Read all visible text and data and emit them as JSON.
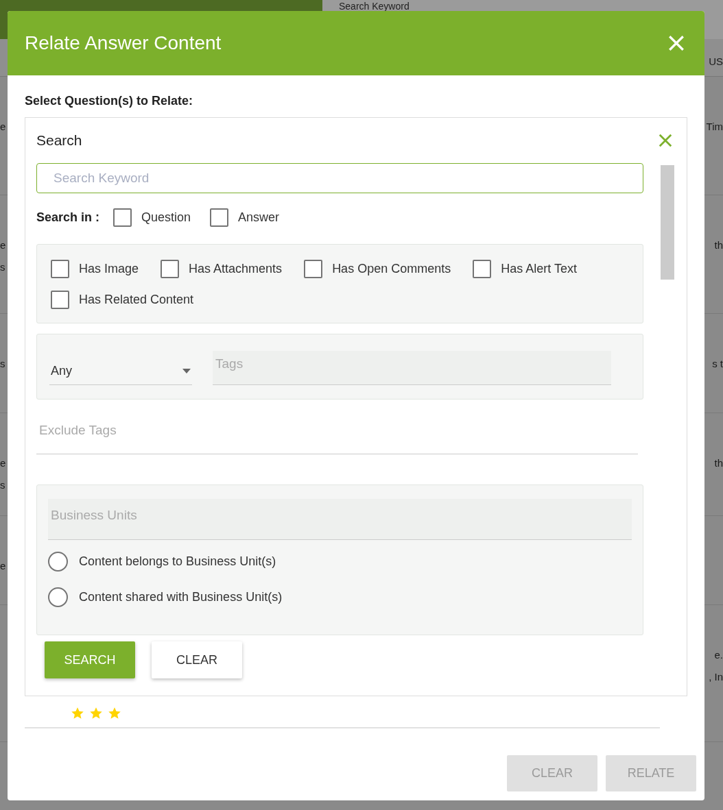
{
  "background": {
    "search_placeholder": "Search Keyword",
    "header_tab": "US",
    "rows": [
      {
        "left": [
          "e"
        ],
        "right": [
          "Tim"
        ]
      },
      {
        "left": [
          "e",
          "s"
        ],
        "right": [
          "th"
        ]
      },
      {
        "left": [
          "s"
        ],
        "right": [
          "s t"
        ]
      },
      {
        "left": [
          "e",
          "s"
        ],
        "right": [
          "th"
        ]
      },
      {
        "left": [
          "e"
        ]
      },
      {
        "right": [
          "e.",
          ", In"
        ]
      }
    ]
  },
  "dialog": {
    "title": "Relate Answer Content",
    "prompt": "Select Question(s) to Relate:",
    "search_panel": {
      "title": "Search",
      "keyword": {
        "placeholder": "Search Keyword",
        "focused": true
      },
      "search_in": {
        "label": "Search in :",
        "options": [
          {
            "label": "Question",
            "checked": false
          },
          {
            "label": "Answer",
            "checked": false
          }
        ]
      },
      "filters": [
        {
          "label": "Has Image",
          "checked": false
        },
        {
          "label": "Has Attachments",
          "checked": false
        },
        {
          "label": "Has Open Comments",
          "checked": false
        },
        {
          "label": "Has Alert Text",
          "checked": false
        },
        {
          "label": "Has Related Content",
          "checked": false
        }
      ],
      "match": {
        "value": "Any"
      },
      "tags": {
        "placeholder": "Tags"
      },
      "exclude_tags": {
        "placeholder": "Exclude Tags"
      },
      "business_units": {
        "placeholder": "Business Units"
      },
      "scope": [
        {
          "label": "Content belongs to Business Unit(s)",
          "selected": false
        },
        {
          "label": "Content shared with Business Unit(s)",
          "selected": false
        }
      ],
      "buttons": [
        {
          "label": "SEARCH",
          "kind": "primary"
        },
        {
          "label": "CLEAR",
          "kind": "secondary"
        }
      ]
    },
    "result": {
      "stars": 3
    },
    "footer_buttons": [
      {
        "label": "CLEAR",
        "disabled": true
      },
      {
        "label": "RELATE",
        "disabled": true
      }
    ]
  }
}
